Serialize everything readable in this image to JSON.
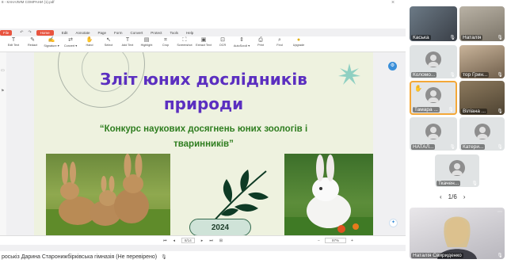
{
  "app": {
    "doc_title": "8 - КАНАЛИМ СОМРАНИ (1).pdf",
    "window_close": "×"
  },
  "menu": {
    "file": "File",
    "home": "Home",
    "items": [
      "Edit",
      "Annotate",
      "Page",
      "Form",
      "Convert",
      "Protect",
      "Tools",
      "Help"
    ],
    "zoom_value": "97%"
  },
  "toolbar": {
    "tools": [
      {
        "label": "Edit Text",
        "icon": "edit-text-icon",
        "glyph": "T"
      },
      {
        "label": "Redact",
        "icon": "redact-icon",
        "glyph": "✎"
      },
      {
        "label": "Signature ▾",
        "icon": "signature-icon",
        "glyph": "✍"
      },
      {
        "label": "Convert ▾",
        "icon": "convert-icon",
        "glyph": "⇄"
      },
      {
        "label": "Hand",
        "icon": "hand-icon",
        "glyph": "✋"
      },
      {
        "label": "Select",
        "icon": "select-icon",
        "glyph": "↖"
      },
      {
        "label": "Add Text",
        "icon": "add-text-icon",
        "glyph": "T"
      },
      {
        "label": "Highlight",
        "icon": "highlight-icon",
        "glyph": "▤"
      },
      {
        "label": "Crop",
        "icon": "crop-icon",
        "glyph": "⌗"
      },
      {
        "label": "Screenshot",
        "icon": "screenshot-icon",
        "glyph": "⛶"
      },
      {
        "label": "Extract Text",
        "icon": "extract-text-icon",
        "glyph": "▣"
      },
      {
        "label": "OCR",
        "icon": "ocr-icon",
        "glyph": "⊡"
      },
      {
        "label": "AutoScroll ▾",
        "icon": "autoscroll-icon",
        "glyph": "⇕"
      },
      {
        "label": "Print",
        "icon": "print-icon",
        "glyph": "⎙"
      },
      {
        "label": "Find",
        "icon": "find-icon",
        "glyph": "⌕"
      },
      {
        "label": "Upgrade",
        "icon": "upgrade-icon",
        "glyph": "●"
      }
    ]
  },
  "slide": {
    "title_line1": "Зліт юних дослідників",
    "title_line2": "природи",
    "subtitle_line1": "“Конкурс наукових досягнень юних зоологів і",
    "subtitle_line2": "тваринників”",
    "year_badge": "2024",
    "colors": {
      "title": "#5b2fc0",
      "subtitle": "#2e7d1f",
      "background": "#eef2df"
    }
  },
  "pdf_nav": {
    "page": "8/14",
    "zoom": "97%"
  },
  "status_bar": {
    "text": "роськіз Дарина Старонижбірківська гімназія (Не перевірено)"
  },
  "participants": [
    {
      "name": "Каська",
      "muted": true
    },
    {
      "name": "Наталія",
      "muted": true
    },
    {
      "name": "Коломо...",
      "muted": true
    },
    {
      "name": "тор Грин...",
      "muted": true
    },
    {
      "name": "Тамара ...",
      "muted": true,
      "hand_raised": true
    },
    {
      "name": "Віліана ...",
      "muted": true
    },
    {
      "name": "НАТАЛ...",
      "muted": true
    },
    {
      "name": "Катери...",
      "muted": true
    },
    {
      "name": "Ткачен...",
      "muted": true
    },
    {
      "name": "Наталія Свириденко",
      "muted": true
    }
  ],
  "pager": {
    "label": "1/6",
    "prev": "‹",
    "next": "›"
  }
}
